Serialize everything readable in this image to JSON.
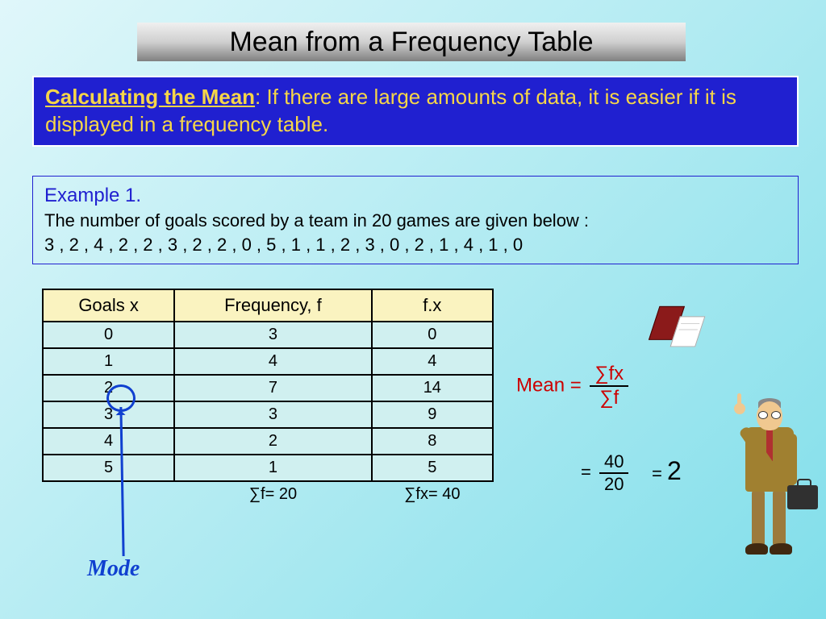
{
  "title": "Mean from a Frequency Table",
  "intro": {
    "lead": "Calculating the Mean",
    "text": ": If there are large amounts of data, it is easier if it is displayed in a frequency table."
  },
  "example": {
    "label": "Example 1.",
    "prompt": "The number of goals scored by a team in 20 games are given below :",
    "data_list": "3 , 2 , 4 , 2 , 2 , 3 , 2 , 2 , 0 , 5 , 1 , 1 , 2 , 3 , 0 , 2 , 1 , 4 , 1 , 0"
  },
  "table": {
    "headers": {
      "x": "Goals  x",
      "f": "Frequency, f",
      "fx": "f.x"
    },
    "rows": [
      {
        "x": "0",
        "f": "3",
        "fx": "0"
      },
      {
        "x": "1",
        "f": "4",
        "fx": "4"
      },
      {
        "x": "2",
        "f": "7",
        "fx": "14"
      },
      {
        "x": "3",
        "f": "3",
        "fx": "9"
      },
      {
        "x": "4",
        "f": "2",
        "fx": "8"
      },
      {
        "x": "5",
        "f": "1",
        "fx": "5"
      }
    ],
    "totals": {
      "sum_f": "∑f= 20",
      "sum_fx": "∑fx= 40"
    }
  },
  "mode_label": "Mode",
  "formula": {
    "label": "Mean =",
    "num": "∑fx",
    "den": "∑f"
  },
  "calc": {
    "eq": "=",
    "num": "40",
    "den": "20",
    "eq2": "=",
    "result": "2"
  }
}
